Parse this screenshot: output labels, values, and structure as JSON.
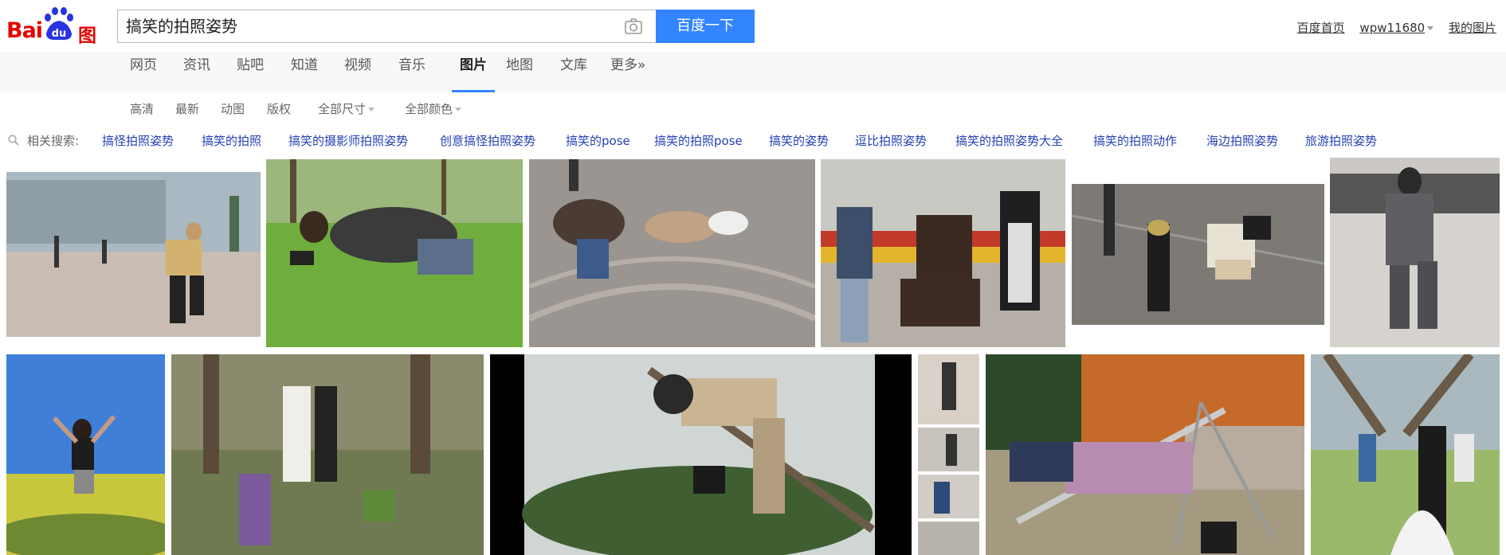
{
  "logo": {
    "bai": "Bai",
    "du": "du",
    "pic": "图片"
  },
  "search": {
    "query": "搞笑的拍照姿势",
    "button": "百度一下"
  },
  "top_links": {
    "home": "百度首页",
    "user": "wpw11680",
    "my_images": "我的图片"
  },
  "nav_tabs": [
    "网页",
    "资讯",
    "贴吧",
    "知道",
    "视频",
    "音乐",
    "图片",
    "地图",
    "文库",
    "更多»"
  ],
  "active_tab": "图片",
  "filters": [
    "高清",
    "最新",
    "动图",
    "版权",
    "全部尺寸",
    "全部颜色"
  ],
  "related": {
    "label": "相关搜索:",
    "links": [
      "搞怪拍照姿势",
      "搞笑的拍照",
      "搞笑的摄影师拍照姿势",
      "创意搞怪拍照姿势",
      "搞笑的pose",
      "搞笑的拍照pose",
      "搞笑的姿势",
      "逗比拍照姿势",
      "搞笑的拍照姿势大全",
      "搞笑的拍照动作",
      "海边拍照姿势",
      "旅游拍照姿势"
    ]
  },
  "colors": {
    "brand_red": "#e10601",
    "brand_blue": "#2932e1",
    "button_blue": "#3385ff",
    "link_blue": "#2440b3"
  },
  "icons": [
    "camera-icon",
    "search-icon",
    "chevron-down-icon"
  ]
}
